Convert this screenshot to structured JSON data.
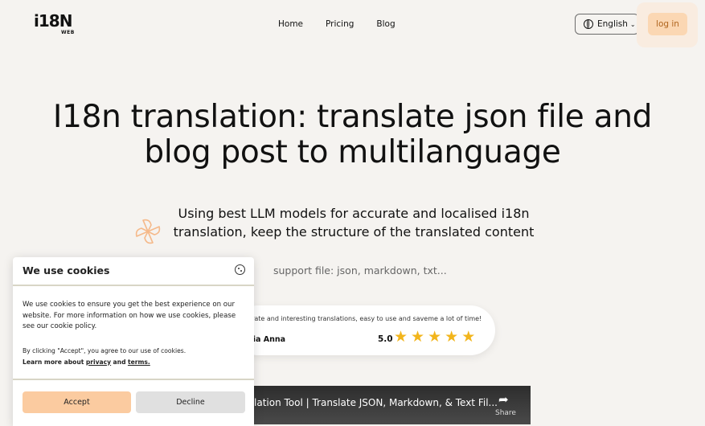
{
  "nav": {
    "logo_text": "i18N",
    "logo_sub": "WEB",
    "links": [
      "Home",
      "Pricing",
      "Blog"
    ],
    "language": "English",
    "login": "log in"
  },
  "hero": {
    "title_line1": "I18n translation: translate json file and",
    "title_line2": "blog post to multilanguage",
    "subtitle_line1": "Using best LLM models for accurate and localised i18n",
    "subtitle_line2": "translation, keep the structure of the translated content",
    "support": "support file: json, markdown, txt..."
  },
  "testimonial": {
    "quote": "urate and interesting translations, easy to use and saveme a lot of time!",
    "author": "dia Anna",
    "rating": "5.0",
    "stars": 5,
    "star_color": "#f2b51c"
  },
  "video": {
    "title": "lation Tool | Translate JSON, Markdown, & Text Fil...",
    "share_label": "Share"
  },
  "cookie": {
    "title": "We use cookies",
    "body": "We use cookies to ensure you get the best experience on our website. For more information on how we use cookies, please see our cookie policy.",
    "accept_note": "By clicking \"Accept\", you agree to our use of cookies.",
    "learn_more": "Learn more about",
    "privacy": "privacy",
    "and": "and",
    "terms": "terms.",
    "accept_button": "Accept",
    "decline_button": "Decline"
  },
  "colors": {
    "accent": "#fbd7b3",
    "background": "#f5f3f0"
  }
}
